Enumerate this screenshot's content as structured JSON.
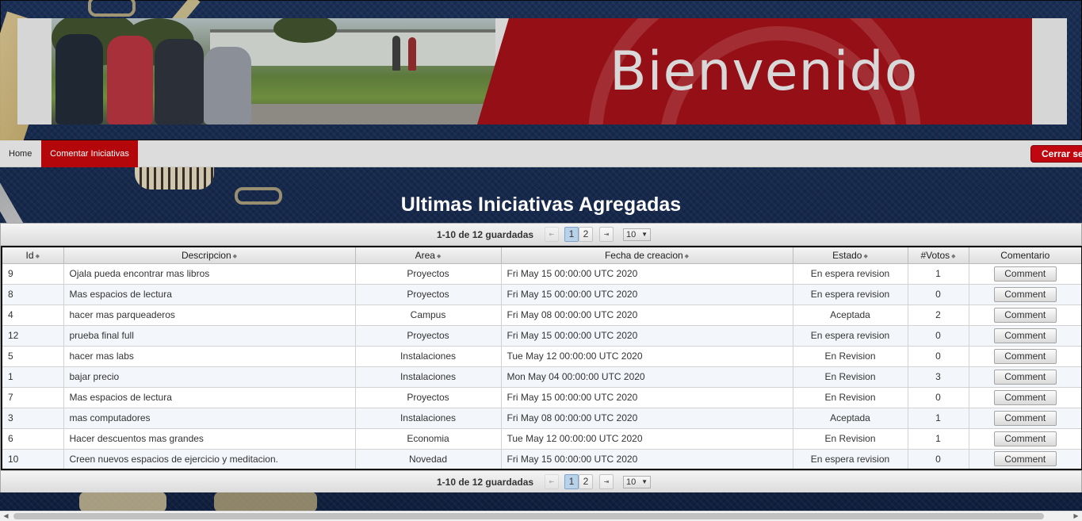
{
  "banner": {
    "title": "Bienvenido"
  },
  "nav": {
    "items": [
      {
        "label": "Home"
      },
      {
        "label": "Comentar Iniciativas"
      }
    ],
    "logout_label": "Cerrar sesión"
  },
  "page": {
    "title": "Ultimas Iniciativas Agregadas"
  },
  "paginator": {
    "report": "1-10 de 12 guardadas",
    "pages": [
      "1",
      "2"
    ],
    "current_page": "1",
    "rows_per_page": "10",
    "icons": {
      "first": "first-page-icon",
      "previous": "previous-page-icon",
      "last": "last-page-icon",
      "dropdown": "chevron-down-icon"
    }
  },
  "table": {
    "columns": [
      "Id",
      "Descripcion",
      "Area",
      "Fecha de creacion",
      "Estado",
      "#Votos",
      "Comentario"
    ],
    "rows": [
      {
        "id": "9",
        "descripcion": "Ojala pueda encontrar mas libros",
        "area": "Proyectos",
        "fecha": "Fri May 15 00:00:00 UTC 2020",
        "estado": "En espera revision",
        "votos": "1",
        "comment": "Comment"
      },
      {
        "id": "8",
        "descripcion": "Mas espacios de lectura",
        "area": "Proyectos",
        "fecha": "Fri May 15 00:00:00 UTC 2020",
        "estado": "En espera revision",
        "votos": "0",
        "comment": "Comment"
      },
      {
        "id": "4",
        "descripcion": "hacer mas parqueaderos",
        "area": "Campus",
        "fecha": "Fri May 08 00:00:00 UTC 2020",
        "estado": "Aceptada",
        "votos": "2",
        "comment": "Comment"
      },
      {
        "id": "12",
        "descripcion": "prueba final full",
        "area": "Proyectos",
        "fecha": "Fri May 15 00:00:00 UTC 2020",
        "estado": "En espera revision",
        "votos": "0",
        "comment": "Comment"
      },
      {
        "id": "5",
        "descripcion": "hacer mas labs",
        "area": "Instalaciones",
        "fecha": "Tue May 12 00:00:00 UTC 2020",
        "estado": "En Revision",
        "votos": "0",
        "comment": "Comment"
      },
      {
        "id": "1",
        "descripcion": "bajar precio",
        "area": "Instalaciones",
        "fecha": "Mon May 04 00:00:00 UTC 2020",
        "estado": "En Revision",
        "votos": "3",
        "comment": "Comment"
      },
      {
        "id": "7",
        "descripcion": "Mas espacios de lectura",
        "area": "Proyectos",
        "fecha": "Fri May 15 00:00:00 UTC 2020",
        "estado": "En Revision",
        "votos": "0",
        "comment": "Comment"
      },
      {
        "id": "3",
        "descripcion": "mas computadores",
        "area": "Instalaciones",
        "fecha": "Fri May 08 00:00:00 UTC 2020",
        "estado": "Aceptada",
        "votos": "1",
        "comment": "Comment"
      },
      {
        "id": "6",
        "descripcion": "Hacer descuentos mas grandes",
        "area": "Economia",
        "fecha": "Tue May 12 00:00:00 UTC 2020",
        "estado": "En Revision",
        "votos": "1",
        "comment": "Comment"
      },
      {
        "id": "10",
        "descripcion": "Creen nuevos espacios de ejercicio y meditacion.",
        "area": "Novedad",
        "fecha": "Fri May 15 00:00:00 UTC 2020",
        "estado": "En espera revision",
        "votos": "0",
        "comment": "Comment"
      }
    ]
  },
  "colors": {
    "brand_red": "#b3070c",
    "banner_red": "#950f16",
    "background_navy": "#142646"
  }
}
